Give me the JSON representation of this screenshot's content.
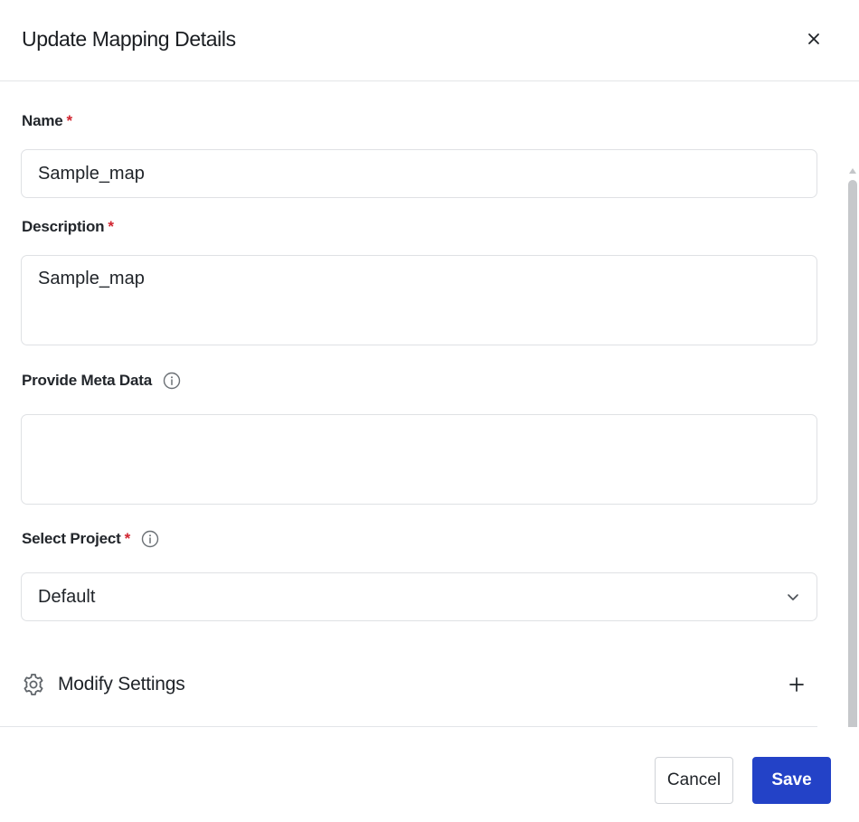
{
  "dialog": {
    "title": "Update Mapping Details",
    "close_icon": "close-icon"
  },
  "form": {
    "name": {
      "label": "Name",
      "required_mark": "*",
      "value": "Sample_map"
    },
    "description": {
      "label": "Description",
      "required_mark": "*",
      "value": "Sample_map"
    },
    "meta_data": {
      "label": "Provide Meta Data",
      "value": "",
      "info_icon": "info-icon"
    },
    "project": {
      "label": "Select Project",
      "required_mark": "*",
      "selected": "Default",
      "info_icon": "info-icon",
      "dropdown_icon": "chevron-down-icon"
    },
    "settings": {
      "label": "Modify Settings",
      "icon": "gear-icon",
      "expand_icon": "plus-icon"
    }
  },
  "footer": {
    "cancel_label": "Cancel",
    "save_label": "Save"
  },
  "colors": {
    "primary": "#2342c7",
    "required": "#d1242f",
    "border": "#dfe1e4"
  }
}
